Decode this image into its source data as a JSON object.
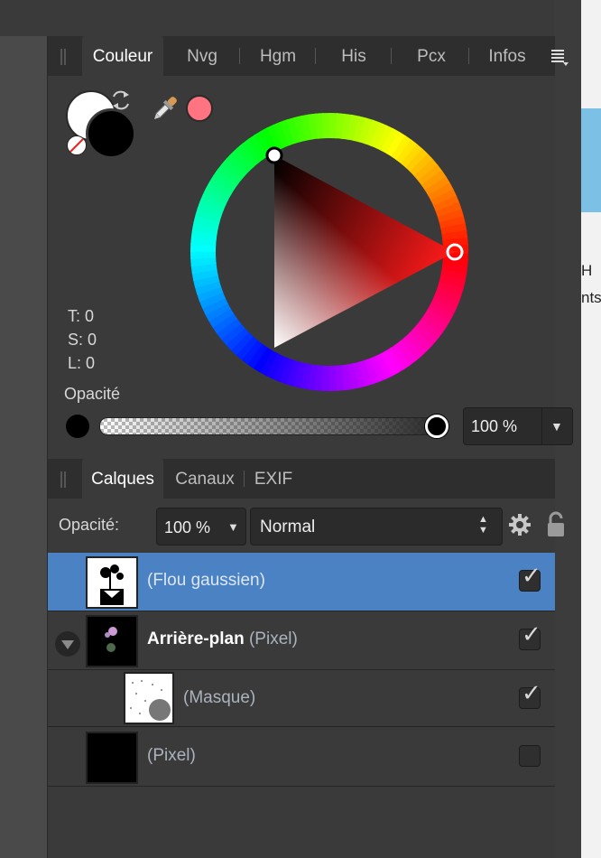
{
  "color_panel": {
    "tabs": [
      "Couleur",
      "Nvg",
      "Hgm",
      "His",
      "Pcx",
      "Infos"
    ],
    "tsl": {
      "t": "T: 0",
      "s": "S: 0",
      "l": "L: 0"
    },
    "opacity_label": "Opacité",
    "opacity_value": "100 %",
    "opacity_fraction": 1.0,
    "current_color": "#ff7480",
    "fill_color": "#000000",
    "stroke_color": "#ffffff",
    "hue_marker_color": "#ff0000"
  },
  "layers_panel": {
    "tabs": [
      "Calques",
      "Canaux",
      "EXIF"
    ],
    "opacity_label": "Opacité:",
    "opacity_value": "100 %",
    "blend_mode": "Normal",
    "layers": [
      {
        "name": "(Flou gaussien)",
        "checked": true,
        "selected": true
      },
      {
        "name_bold": "Arrière-plan",
        "name": "(Pixel)",
        "checked": true,
        "selected": false
      },
      {
        "name": "(Masque)",
        "checked": true,
        "selected": false
      },
      {
        "name": "(Pixel)",
        "checked": false,
        "selected": false
      }
    ]
  },
  "background_app": {
    "text_h": "H",
    "text_nts": "nts"
  }
}
